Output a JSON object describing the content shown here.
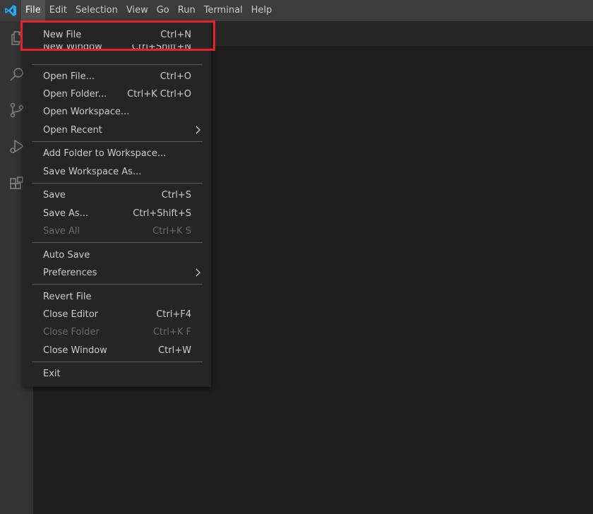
{
  "menubar": {
    "items": [
      {
        "label": "File"
      },
      {
        "label": "Edit"
      },
      {
        "label": "Selection"
      },
      {
        "label": "View"
      },
      {
        "label": "Go"
      },
      {
        "label": "Run"
      },
      {
        "label": "Terminal"
      },
      {
        "label": "Help"
      }
    ]
  },
  "activity_bar": {
    "icons": [
      "explorer-icon",
      "search-icon",
      "source-control-icon",
      "run-debug-icon",
      "extensions-icon"
    ]
  },
  "file_menu": {
    "items": [
      {
        "label": "New File",
        "shortcut": "Ctrl+N"
      },
      {
        "label": "New Window",
        "shortcut": "Ctrl+Shift+N"
      },
      {
        "label": "Open File...",
        "shortcut": "Ctrl+O"
      },
      {
        "label": "Open Folder...",
        "shortcut": "Ctrl+K Ctrl+O"
      },
      {
        "label": "Open Workspace...",
        "shortcut": ""
      },
      {
        "label": "Open Recent",
        "shortcut": ""
      },
      {
        "label": "Add Folder to Workspace...",
        "shortcut": ""
      },
      {
        "label": "Save Workspace As...",
        "shortcut": ""
      },
      {
        "label": "Save",
        "shortcut": "Ctrl+S"
      },
      {
        "label": "Save As...",
        "shortcut": "Ctrl+Shift+S"
      },
      {
        "label": "Save All",
        "shortcut": "Ctrl+K S"
      },
      {
        "label": "Auto Save",
        "shortcut": ""
      },
      {
        "label": "Preferences",
        "shortcut": ""
      },
      {
        "label": "Revert File",
        "shortcut": ""
      },
      {
        "label": "Close Editor",
        "shortcut": "Ctrl+F4"
      },
      {
        "label": "Close Folder",
        "shortcut": "Ctrl+K F"
      },
      {
        "label": "Close Window",
        "shortcut": "Ctrl+W"
      },
      {
        "label": "Exit",
        "shortcut": ""
      }
    ]
  },
  "colors": {
    "highlight": "#e8212a",
    "accent": "#23a9f2"
  }
}
